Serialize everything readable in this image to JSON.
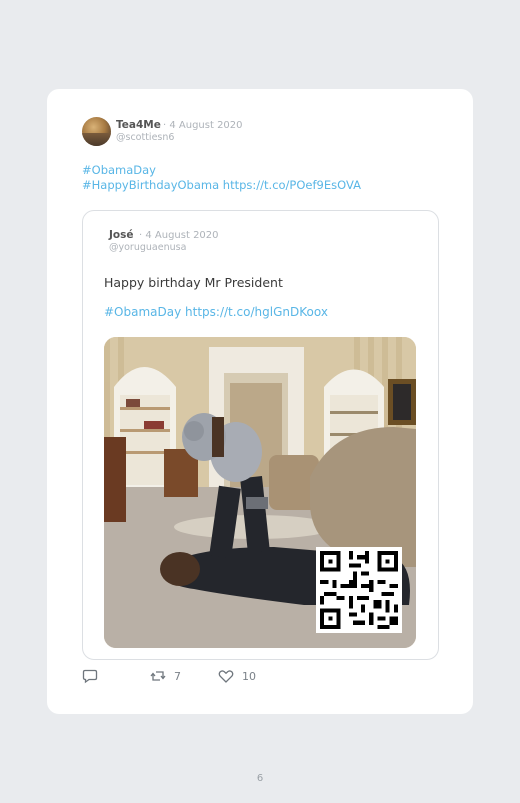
{
  "tweet": {
    "author_name": "Tea4Me",
    "date": "· 4 August 2020",
    "handle": "@scottiesn6",
    "line1": "#ObamaDay",
    "line2": "#HappyBirthdayObama https://t.co/POef9EsOVA"
  },
  "quoted": {
    "author_name": "José",
    "date": "· 4 August 2020",
    "handle": "@yoruguaenusa",
    "text": "Happy birthday Mr President",
    "links": "#ObamaDay https://t.co/hglGnDKoox"
  },
  "actions": {
    "reply_icon": "reply-icon",
    "retweet_icon": "retweet-icon",
    "retweet_count": "7",
    "like_icon": "heart-icon",
    "like_count": "10"
  },
  "page_number": "6",
  "colors": {
    "link": "#59b6e6",
    "background": "#e9ebee"
  }
}
